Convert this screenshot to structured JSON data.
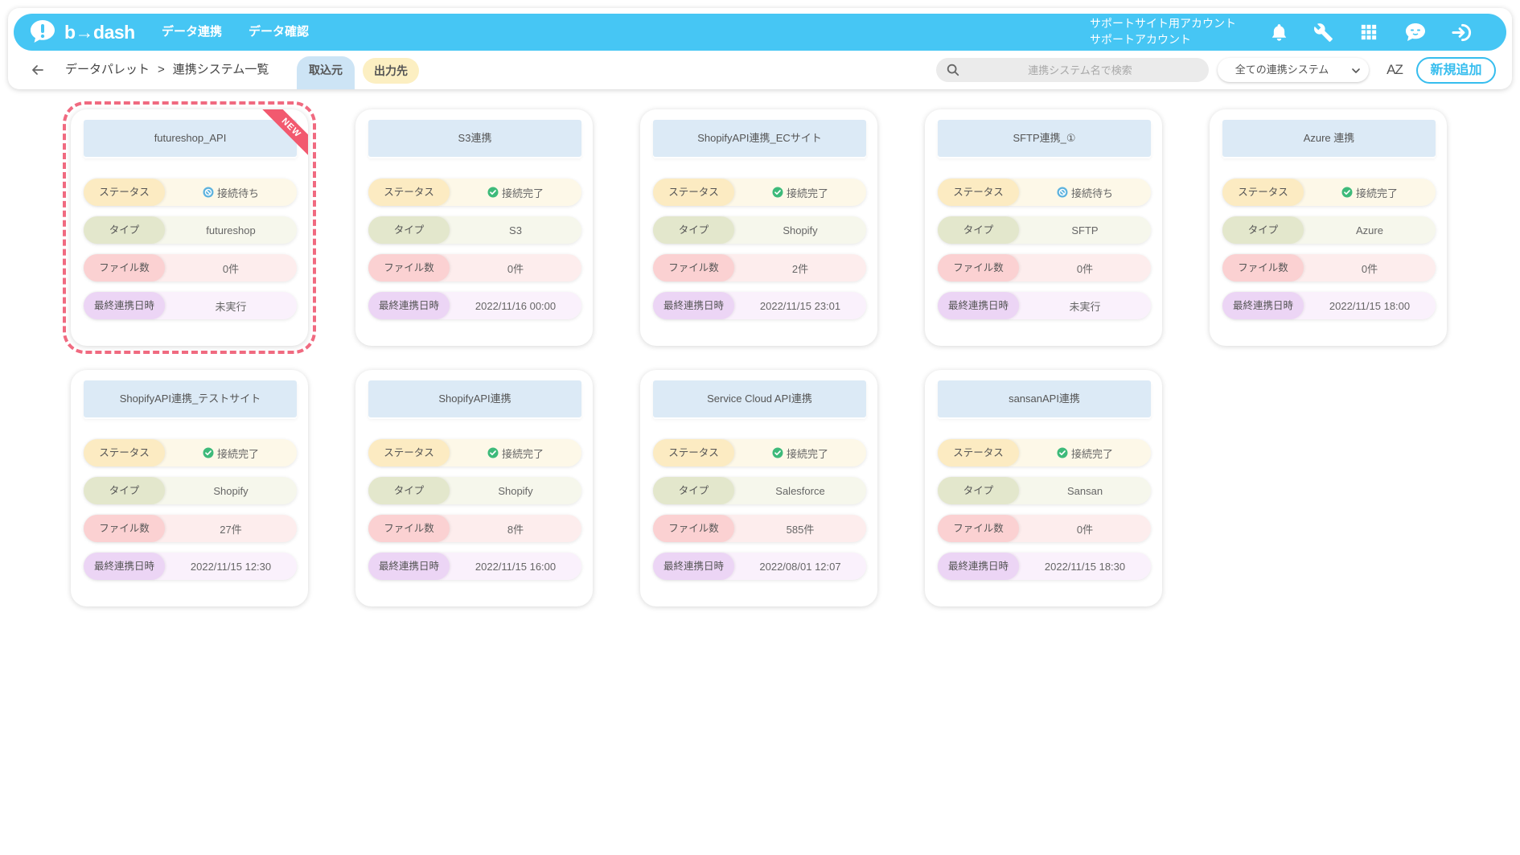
{
  "colors": {
    "header": "#46c6f4",
    "accent": "#36bdee",
    "highlight": "#f06a80",
    "ribbon": "#f2596f",
    "title_bg": "#dceaf6",
    "tab_import": "#cde4f5",
    "tab_export": "#fcefc2",
    "status_label": "#fcebc2",
    "status_value": "#fdf8e8",
    "type_label": "#e3e7cc",
    "type_value": "#f6f7ec",
    "files_label": "#fbd1d2",
    "files_value": "#fdeded",
    "date_label": "#ecd5f5",
    "date_value": "#faf1fc",
    "connected": "#3dba7a",
    "waiting": "#5cb2de"
  },
  "header": {
    "logo_text": "b→dash",
    "nav": [
      {
        "label": "データ連携"
      },
      {
        "label": "データ確認"
      }
    ],
    "account": {
      "site": "サポートサイト用アカウント",
      "name": "サポートアカウント"
    },
    "icons": [
      "bell-icon",
      "wrench-icon",
      "grid-icon",
      "chat-icon",
      "logout-icon"
    ]
  },
  "toolbar": {
    "breadcrumb": {
      "parent": "データパレット",
      "separator": ">",
      "current": "連携システム一覧"
    },
    "tabs": [
      {
        "label": "取込元",
        "active": true
      },
      {
        "label": "出力先",
        "active": false
      }
    ],
    "search_placeholder": "連携システム名で検索",
    "filter_selected": "全ての連携システム",
    "sort_label": "AZ",
    "add_button": "新規追加"
  },
  "row_labels": {
    "status": "ステータス",
    "type": "タイプ",
    "files": "ファイル数",
    "last_sync": "最終連携日時"
  },
  "cards": [
    {
      "title": "futureshop_API",
      "badge": "NEW",
      "highlighted": true,
      "status": "接続待ち",
      "status_icon": "waiting-icon",
      "type": "futureshop",
      "files": "0件",
      "last_sync": "未実行"
    },
    {
      "title": "S3連携",
      "status": "接続完了",
      "status_icon": "connected-icon",
      "type": "S3",
      "files": "0件",
      "last_sync": "2022/11/16 00:00"
    },
    {
      "title": "ShopifyAPI連携_ECサイト",
      "status": "接続完了",
      "status_icon": "connected-icon",
      "type": "Shopify",
      "files": "2件",
      "last_sync": "2022/11/15 23:01"
    },
    {
      "title": "SFTP連携_①",
      "status": "接続待ち",
      "status_icon": "waiting-icon",
      "type": "SFTP",
      "files": "0件",
      "last_sync": "未実行"
    },
    {
      "title": "Azure 連携",
      "status": "接続完了",
      "status_icon": "connected-icon",
      "type": "Azure",
      "files": "0件",
      "last_sync": "2022/11/15 18:00"
    },
    {
      "title": "ShopifyAPI連携_テストサイト",
      "status": "接続完了",
      "status_icon": "connected-icon",
      "type": "Shopify",
      "files": "27件",
      "last_sync": "2022/11/15 12:30"
    },
    {
      "title": "ShopifyAPI連携",
      "status": "接続完了",
      "status_icon": "connected-icon",
      "type": "Shopify",
      "files": "8件",
      "last_sync": "2022/11/15 16:00"
    },
    {
      "title": "Service Cloud API連携",
      "status": "接続完了",
      "status_icon": "connected-icon",
      "type": "Salesforce",
      "files": "585件",
      "last_sync": "2022/08/01 12:07"
    },
    {
      "title": "sansanAPI連携",
      "status": "接続完了",
      "status_icon": "connected-icon",
      "type": "Sansan",
      "files": "0件",
      "last_sync": "2022/11/15 18:30"
    }
  ]
}
